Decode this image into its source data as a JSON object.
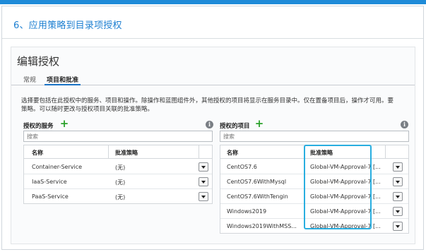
{
  "step": {
    "title": "6、应用策略到目录项授权"
  },
  "panel": {
    "title": "编辑授权"
  },
  "tabs": [
    {
      "label": "常规"
    },
    {
      "label": "项目和批准"
    }
  ],
  "description": {
    "line1": "选择要包括在此授权中的服务、项目和操作。除操作和蓝图组件外，其他授权的项目将显示在服务目录中。仅在置备项目后，操作才可用。要",
    "line2": "策略。可以随时更改与授权项目关联的批准策略。"
  },
  "services": {
    "label": "授权的服务",
    "search_placeholder": "搜索",
    "headers": {
      "name": "名称",
      "policy": "批准策略"
    },
    "rows": [
      {
        "name": "Container-Service",
        "policy": "(无)"
      },
      {
        "name": "IaaS-Service",
        "policy": "(无)"
      },
      {
        "name": "PaaS-Service",
        "policy": "(无)"
      }
    ]
  },
  "items": {
    "label": "授权的项目",
    "search_placeholder": "搜索",
    "headers": {
      "name": "名称",
      "policy": "批准策略"
    },
    "rows": [
      {
        "name": "CentOS7.6",
        "policy": "Global-VM-Approval-7",
        "suffix": "[..."
      },
      {
        "name": "CentOS7.6WithMysql",
        "policy": "Global-VM-Approval-7",
        "suffix": "[..."
      },
      {
        "name": "CentOS7.6WithTengin",
        "policy": "Global-VM-Approval-7",
        "suffix": "[..."
      },
      {
        "name": "Windows2019",
        "policy": "Global-VM-Approval-7",
        "suffix": "[..."
      },
      {
        "name": "Windows2019WithMSS...",
        "policy": "Global-VM-Approval-7",
        "suffix": "[..."
      }
    ]
  },
  "icons": {
    "add": "plus-icon",
    "info": "info-icon",
    "dropdown": "chevron-down-icon"
  },
  "colors": {
    "accent": "#1f8bd8",
    "title": "#1c7fd1",
    "add": "#2aa12a",
    "highlight": "#29aee0"
  }
}
